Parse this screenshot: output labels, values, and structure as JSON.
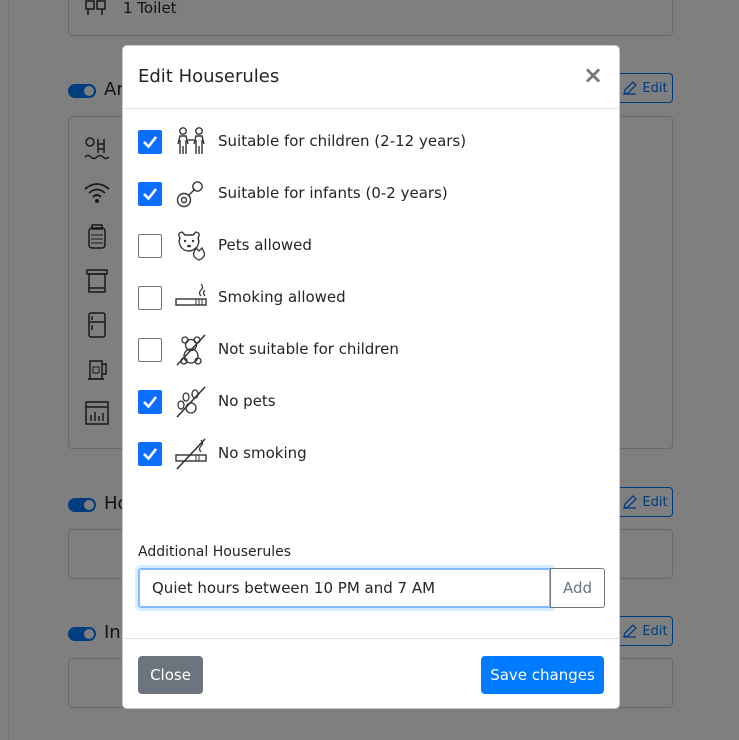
{
  "background": {
    "top_card_text": "1 Toilet",
    "sections": [
      {
        "label": "Am",
        "edit_label": "Edit"
      },
      {
        "label": "Ho",
        "edit_label": "Edit"
      },
      {
        "label": "In",
        "edit_label": "Edit"
      }
    ]
  },
  "modal": {
    "title": "Edit Houserules",
    "close_symbol": "×",
    "rules": [
      {
        "label": "Suitable for children (2-12 years)",
        "checked": true,
        "icon": "children-icon"
      },
      {
        "label": "Suitable for infants (0-2 years)",
        "checked": true,
        "icon": "pacifier-icon"
      },
      {
        "label": "Pets allowed",
        "checked": false,
        "icon": "pets-icon"
      },
      {
        "label": "Smoking allowed",
        "checked": false,
        "icon": "cigarette-icon"
      },
      {
        "label": "Not suitable for children",
        "checked": false,
        "icon": "no-children-icon"
      },
      {
        "label": "No pets",
        "checked": true,
        "icon": "no-pets-icon"
      },
      {
        "label": "No smoking",
        "checked": true,
        "icon": "no-smoking-icon"
      }
    ],
    "additional": {
      "label": "Additional Houserules",
      "value": "Quiet hours between 10 PM and 7 AM",
      "add_label": "Add"
    },
    "footer": {
      "close_label": "Close",
      "save_label": "Save changes"
    }
  },
  "colors": {
    "primary": "#007bff",
    "secondary": "#6c757d"
  }
}
